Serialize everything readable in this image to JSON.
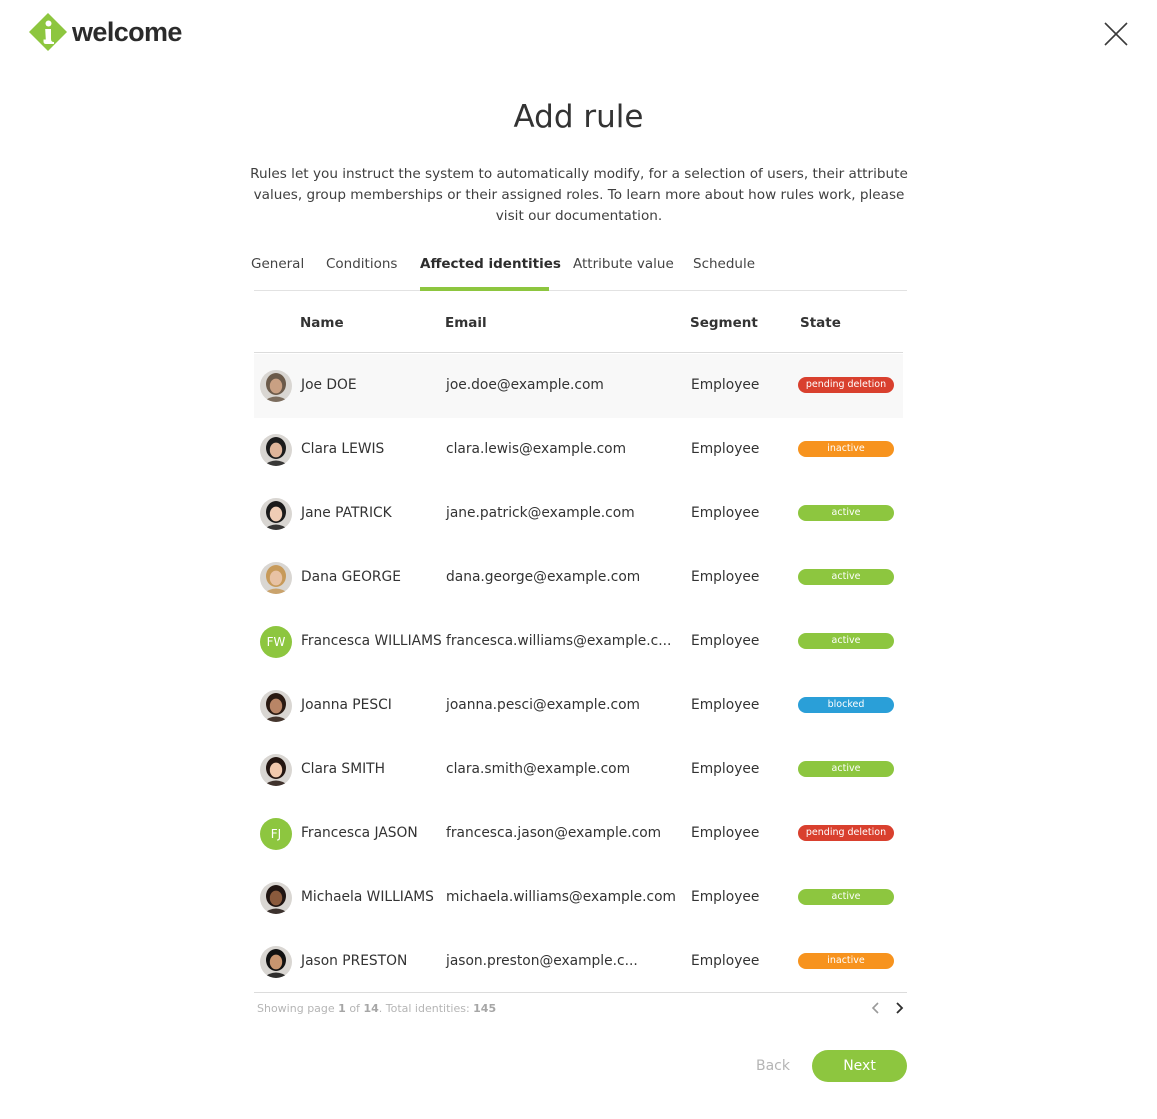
{
  "brand": {
    "name": "welcome",
    "accent": "#8dc63f",
    "logo_letter": "i"
  },
  "title": "Add rule",
  "description": "Rules let you instruct the system to automatically modify, for a selection of users, their attribute values, group memberships or their assigned roles. To learn more about how rules work, please visit our documentation.",
  "tabs": [
    {
      "label": "General",
      "active": false
    },
    {
      "label": "Conditions",
      "active": false
    },
    {
      "label": "Affected identities",
      "active": true
    },
    {
      "label": "Attribute value",
      "active": false
    },
    {
      "label": "Schedule",
      "active": false
    }
  ],
  "table": {
    "columns": {
      "name": "Name",
      "email": "Email",
      "segment": "Segment",
      "state": "State"
    },
    "rows": [
      {
        "name": "Joe DOE",
        "email": "joe.doe@example.com",
        "segment": "Employee",
        "state": "pending deletion",
        "avatar": "photo",
        "initials": ""
      },
      {
        "name": "Clara LEWIS",
        "email": "clara.lewis@example.com",
        "segment": "Employee",
        "state": "inactive",
        "avatar": "photo",
        "initials": ""
      },
      {
        "name": "Jane PATRICK",
        "email": "jane.patrick@example.com",
        "segment": "Employee",
        "state": "active",
        "avatar": "photo",
        "initials": ""
      },
      {
        "name": "Dana GEORGE",
        "email": "dana.george@example.com",
        "segment": "Employee",
        "state": "active",
        "avatar": "photo",
        "initials": ""
      },
      {
        "name": "Francesca WILLIAMS",
        "email": "francesca.williams@example.c...",
        "segment": "Employee",
        "state": "active",
        "avatar": "initials",
        "initials": "FW"
      },
      {
        "name": "Joanna PESCI",
        "email": "joanna.pesci@example.com",
        "segment": "Employee",
        "state": "blocked",
        "avatar": "photo",
        "initials": ""
      },
      {
        "name": "Clara SMITH",
        "email": "clara.smith@example.com",
        "segment": "Employee",
        "state": "active",
        "avatar": "photo",
        "initials": ""
      },
      {
        "name": "Francesca JASON",
        "email": "francesca.jason@example.com",
        "segment": "Employee",
        "state": "pending deletion",
        "avatar": "initials",
        "initials": "FJ"
      },
      {
        "name": "Michaela WILLIAMS",
        "email": "michaela.williams@example.com",
        "segment": "Employee",
        "state": "active",
        "avatar": "photo",
        "initials": ""
      },
      {
        "name": "Jason PRESTON",
        "email": "jason.preston@example.c...",
        "segment": "Employee",
        "state": "inactive",
        "avatar": "photo",
        "initials": ""
      }
    ]
  },
  "state_colors": {
    "pending deletion": "#d9402e",
    "inactive": "#f7931e",
    "active": "#8dc63f",
    "blocked": "#2a9fd8"
  },
  "pagination": {
    "showing_page_label": "Showing page",
    "current_page": "1",
    "of_label": "of",
    "total_pages": "14",
    "total_label": ". Total identities:",
    "total_identities": "145",
    "prev_icon": "chevron-left-icon",
    "next_icon": "chevron-right-icon"
  },
  "actions": {
    "back_label": "Back",
    "next_label": "Next"
  },
  "icons": {
    "close": "close-icon"
  }
}
